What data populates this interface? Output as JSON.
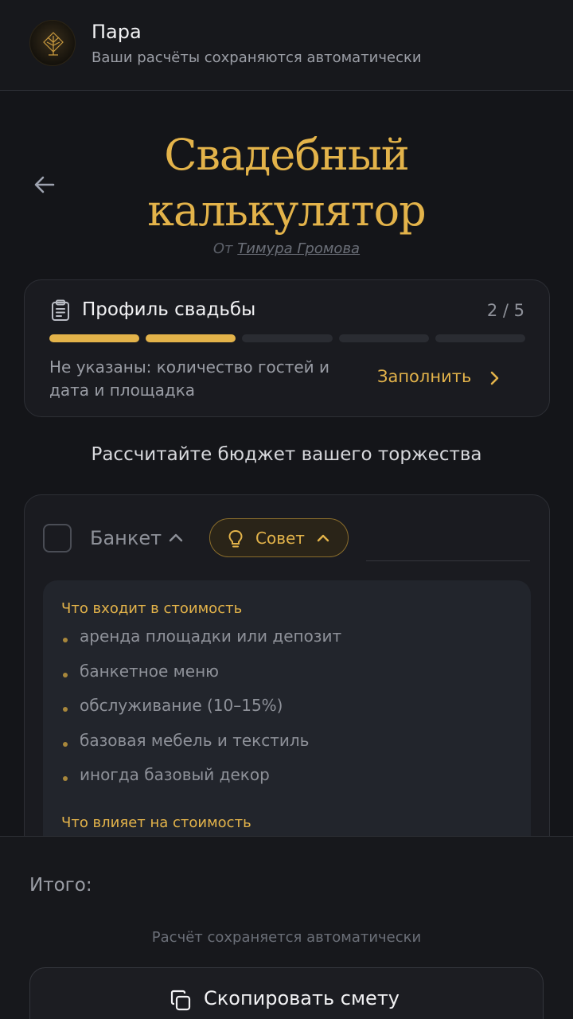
{
  "header": {
    "title": "Пара",
    "subtitle": "Ваши расчёты сохраняются автоматически",
    "avatar_icon": "tree-logo-icon"
  },
  "page": {
    "back_icon": "arrow-left-icon",
    "title_line1": "Свадебный",
    "title_line2": "калькулятор",
    "byline_prefix": "От",
    "byline_author": "Тимура Громова",
    "tagline": "Рассчитайте бюджет вашего торжества"
  },
  "profile": {
    "icon": "clipboard-icon",
    "title": "Профиль свадьбы",
    "step": "2 / 5",
    "progress_done": 2,
    "progress_total": 5,
    "missing": "Не указаны: количество гостей и дата и площадка",
    "fill_label": "Заполнить"
  },
  "banquet": {
    "label": "Банкет",
    "tip_label": "Совет",
    "includes_heading": "Что входит в стоимость",
    "includes": [
      "аренда площадки или депозит",
      "банкетное меню",
      "обслуживание (10–15%)",
      "базовая мебель и текстиль",
      "иногда базовый декор"
    ],
    "affects_heading": "Что влияет на стоимость"
  },
  "footer": {
    "total_label": "Итого:",
    "autosave": "Расчёт сохраняется автоматически",
    "copy_label": "Скопировать смету"
  },
  "colors": {
    "accent": "#e3b34a",
    "background": "#141519",
    "card": "#1a1b20"
  }
}
